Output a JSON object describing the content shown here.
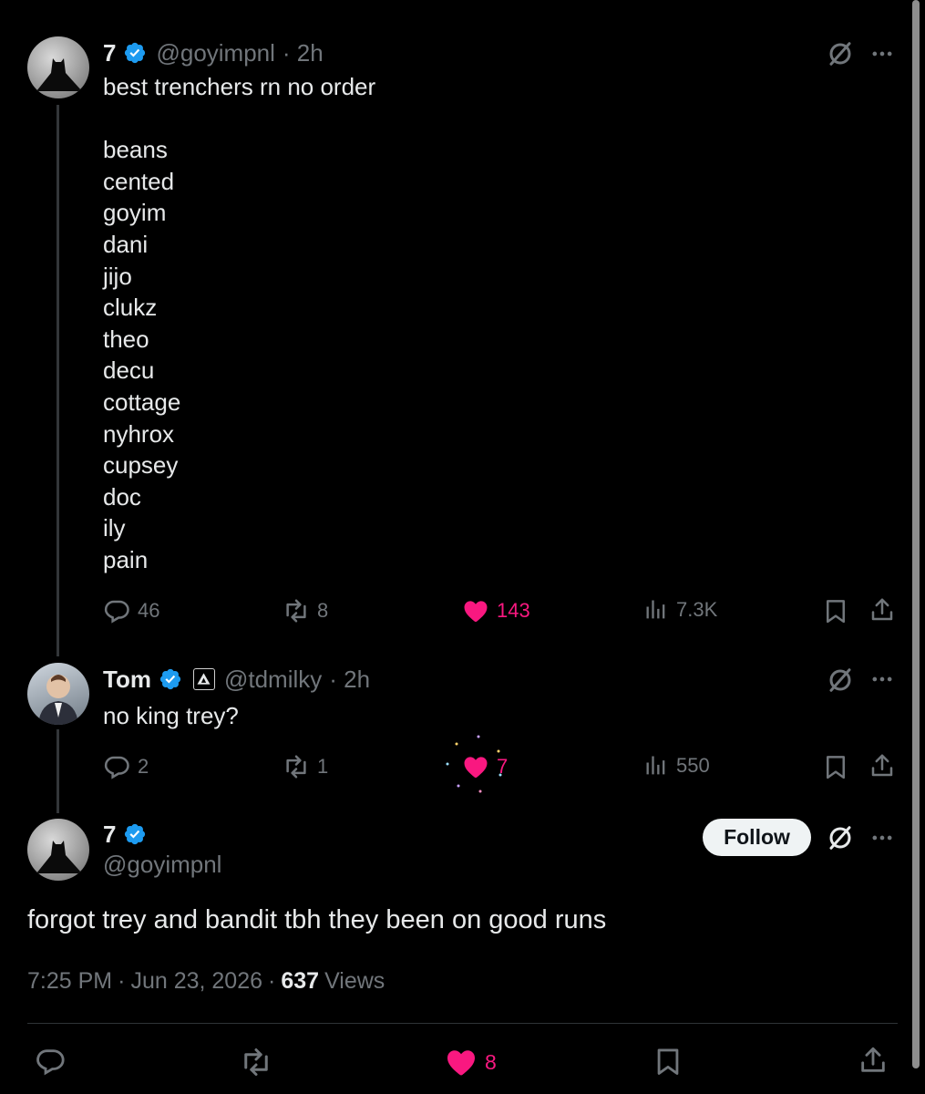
{
  "tweet1": {
    "name": "7",
    "handle": "@goyimpnl",
    "time": "· 2h",
    "text_first": "best trenchers rn no order",
    "list": [
      "beans",
      "cented",
      "goyim",
      "dani",
      "jijo",
      "clukz",
      "theo",
      "decu",
      "cottage",
      "nyhrox",
      "cupsey",
      "doc",
      "ily",
      "pain"
    ],
    "replies": "46",
    "reposts": "8",
    "likes": "143",
    "views": "7.3K"
  },
  "tweet2": {
    "name": "Tom",
    "handle": "@tdmilky",
    "time": "· 2h",
    "text": "no king trey?",
    "replies": "2",
    "reposts": "1",
    "likes": "7",
    "views": "550"
  },
  "main": {
    "name": "7",
    "handle": "@goyimpnl",
    "follow_label": "Follow",
    "text": "forgot trey and bandit tbh they been on good runs",
    "time": "7:25 PM",
    "date": "Jun 23, 2026",
    "sep1": "·",
    "sep2": "·",
    "views_count": "637",
    "views_label": "Views",
    "likes": "8"
  },
  "icons": {
    "verified": "verified-badge-icon",
    "grok": "grok-icon",
    "more": "more-icon",
    "reply": "reply-icon",
    "repost": "repost-icon",
    "like": "like-icon",
    "views": "views-icon",
    "bookmark": "bookmark-icon",
    "share": "share-icon",
    "affiliate": "affiliate-badge-icon"
  },
  "colors": {
    "background": "#000000",
    "text": "#e7e9ea",
    "secondary": "#71767b",
    "like_pink": "#f91880",
    "verified_blue": "#1d9bf0"
  }
}
